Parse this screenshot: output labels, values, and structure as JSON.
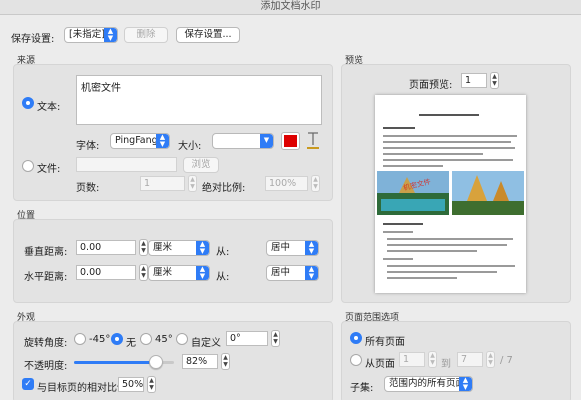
{
  "window": {
    "title": "添加文档水印"
  },
  "settings": {
    "save_label": "保存设置:",
    "preset_value": "[未指定]",
    "delete_label": "删除",
    "save_settings_label": "保存设置..."
  },
  "source": {
    "section_title": "来源",
    "text_radio_label": "文本:",
    "text_value": "机密文件",
    "font_label": "字体:",
    "font_value": "PingFang",
    "size_label": "大小:",
    "size_value": "",
    "text_color": "#dd0000",
    "file_radio_label": "文件:",
    "file_value": "",
    "browse_label": "浏览",
    "page_count_label": "页数:",
    "page_count_value": "1",
    "abs_scale_label": "绝对比例:",
    "abs_scale_value": "100%"
  },
  "position": {
    "section_title": "位置",
    "vertical_label": "垂直距离:",
    "vertical_value": "0.00",
    "vertical_unit": "厘米",
    "vertical_from_label": "从:",
    "vertical_from_value": "居中",
    "horizontal_label": "水平距离:",
    "horizontal_value": "0.00",
    "horizontal_unit": "厘米",
    "horizontal_from_label": "从:",
    "horizontal_from_value": "居中"
  },
  "appearance": {
    "section_title": "外观",
    "rotation_label": "旋转角度:",
    "rot_neg45_label": "-45°",
    "rot_none_label": "无",
    "rot_45_label": "45°",
    "rot_custom_label": "自定义",
    "rot_custom_value": "0°",
    "opacity_label": "不透明度:",
    "opacity_value": "82%",
    "opacity_level": 0.82,
    "relative_scale_label": "与目标页的相对比例",
    "relative_scale_value": "50%"
  },
  "preview": {
    "section_title": "预览",
    "page_preview_label": "页面预览:",
    "page_preview_value": "1"
  },
  "page_range": {
    "section_title": "页面范围选项",
    "all_pages_label": "所有页面",
    "from_page_label": "从页面",
    "from_value": "1",
    "to_label": "到",
    "to_value": "7",
    "total_label": "/ 7",
    "subset_label": "子集:",
    "subset_value": "范围内的所有页面"
  }
}
